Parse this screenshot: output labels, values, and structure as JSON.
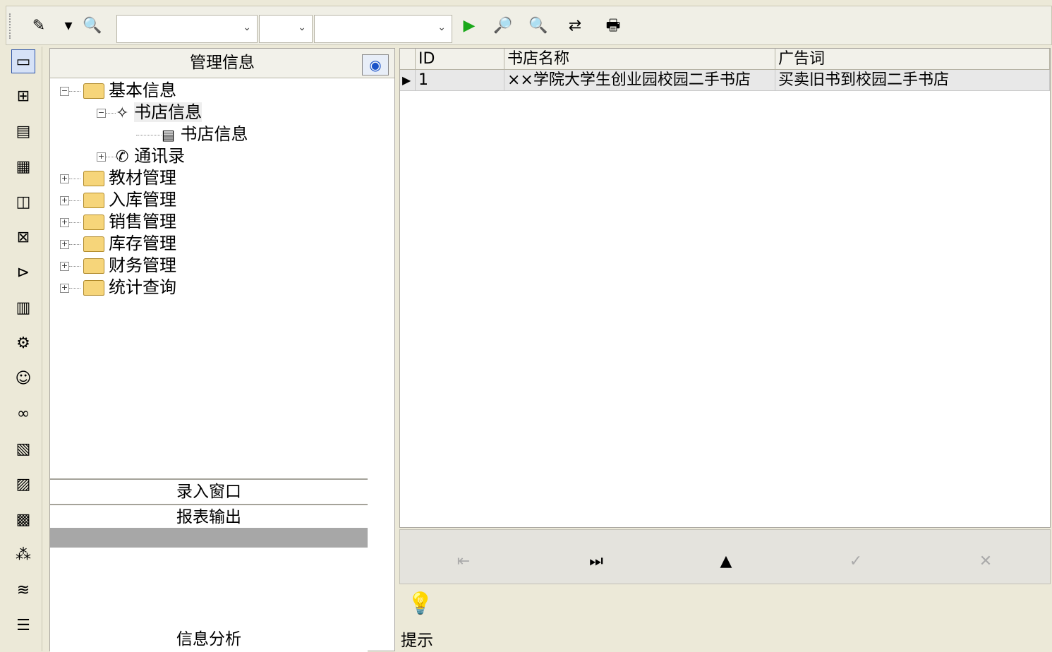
{
  "toolbar": {
    "combo1": "",
    "combo2": "",
    "combo3": ""
  },
  "nav": {
    "title": "管理信息",
    "tree": {
      "basic": "基本信息",
      "bookstore_group": "书店信息",
      "bookstore_item": "书店信息",
      "contacts": "通讯录",
      "textbook": "教材管理",
      "inbound": "入库管理",
      "sales": "销售管理",
      "stock": "库存管理",
      "finance": "财务管理",
      "stats": "统计查询"
    },
    "entry_window": "录入窗口",
    "report_output": "报表输出",
    "info_analysis": "信息分析"
  },
  "grid": {
    "headers": [
      "ID",
      "书店名称",
      "广告词"
    ],
    "rows": [
      [
        "1",
        "××学院大学生创业园校园二手书店",
        "买卖旧书到校园二手书店"
      ]
    ]
  },
  "hint": {
    "label": "提示"
  }
}
